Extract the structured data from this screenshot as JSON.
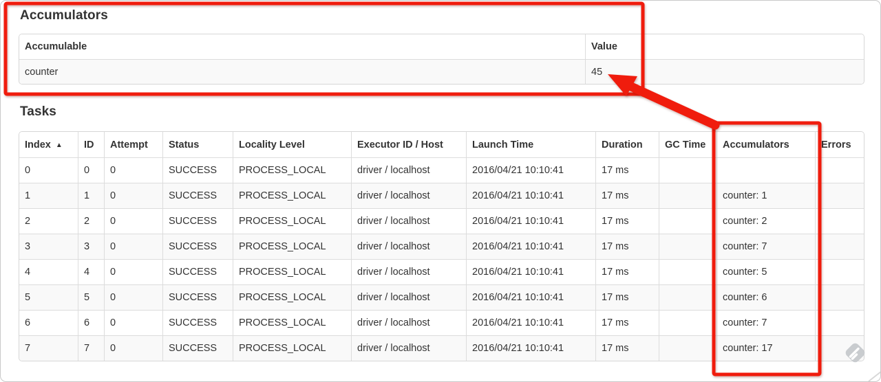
{
  "accumulators_section": {
    "heading": "Accumulators",
    "table": {
      "headers": [
        "Accumulable",
        "Value"
      ],
      "rows": [
        {
          "name": "counter",
          "value": "45"
        }
      ]
    }
  },
  "tasks_section": {
    "heading": "Tasks",
    "table": {
      "headers": [
        "Index",
        "ID",
        "Attempt",
        "Status",
        "Locality Level",
        "Executor ID / Host",
        "Launch Time",
        "Duration",
        "GC Time",
        "Accumulators",
        "Errors"
      ],
      "sort_indicator": "▲",
      "rows": [
        {
          "index": "0",
          "id": "0",
          "attempt": "0",
          "status": "SUCCESS",
          "locality_level": "PROCESS_LOCAL",
          "executor_id_host": "driver / localhost",
          "launch_time": "2016/04/21 10:10:41",
          "duration": "17 ms",
          "gc_time": "",
          "accumulators": "",
          "errors": ""
        },
        {
          "index": "1",
          "id": "1",
          "attempt": "0",
          "status": "SUCCESS",
          "locality_level": "PROCESS_LOCAL",
          "executor_id_host": "driver / localhost",
          "launch_time": "2016/04/21 10:10:41",
          "duration": "17 ms",
          "gc_time": "",
          "accumulators": "counter: 1",
          "errors": ""
        },
        {
          "index": "2",
          "id": "2",
          "attempt": "0",
          "status": "SUCCESS",
          "locality_level": "PROCESS_LOCAL",
          "executor_id_host": "driver / localhost",
          "launch_time": "2016/04/21 10:10:41",
          "duration": "17 ms",
          "gc_time": "",
          "accumulators": "counter: 2",
          "errors": ""
        },
        {
          "index": "3",
          "id": "3",
          "attempt": "0",
          "status": "SUCCESS",
          "locality_level": "PROCESS_LOCAL",
          "executor_id_host": "driver / localhost",
          "launch_time": "2016/04/21 10:10:41",
          "duration": "17 ms",
          "gc_time": "",
          "accumulators": "counter: 7",
          "errors": ""
        },
        {
          "index": "4",
          "id": "4",
          "attempt": "0",
          "status": "SUCCESS",
          "locality_level": "PROCESS_LOCAL",
          "executor_id_host": "driver / localhost",
          "launch_time": "2016/04/21 10:10:41",
          "duration": "17 ms",
          "gc_time": "",
          "accumulators": "counter: 5",
          "errors": ""
        },
        {
          "index": "5",
          "id": "5",
          "attempt": "0",
          "status": "SUCCESS",
          "locality_level": "PROCESS_LOCAL",
          "executor_id_host": "driver / localhost",
          "launch_time": "2016/04/21 10:10:41",
          "duration": "17 ms",
          "gc_time": "",
          "accumulators": "counter: 6",
          "errors": ""
        },
        {
          "index": "6",
          "id": "6",
          "attempt": "0",
          "status": "SUCCESS",
          "locality_level": "PROCESS_LOCAL",
          "executor_id_host": "driver / localhost",
          "launch_time": "2016/04/21 10:10:41",
          "duration": "17 ms",
          "gc_time": "",
          "accumulators": "counter: 7",
          "errors": ""
        },
        {
          "index": "7",
          "id": "7",
          "attempt": "0",
          "status": "SUCCESS",
          "locality_level": "PROCESS_LOCAL",
          "executor_id_host": "driver / localhost",
          "launch_time": "2016/04/21 10:10:41",
          "duration": "17 ms",
          "gc_time": "",
          "accumulators": "counter: 17",
          "errors": ""
        }
      ]
    }
  },
  "annotations": {
    "highlight_color": "#f01c0d"
  }
}
